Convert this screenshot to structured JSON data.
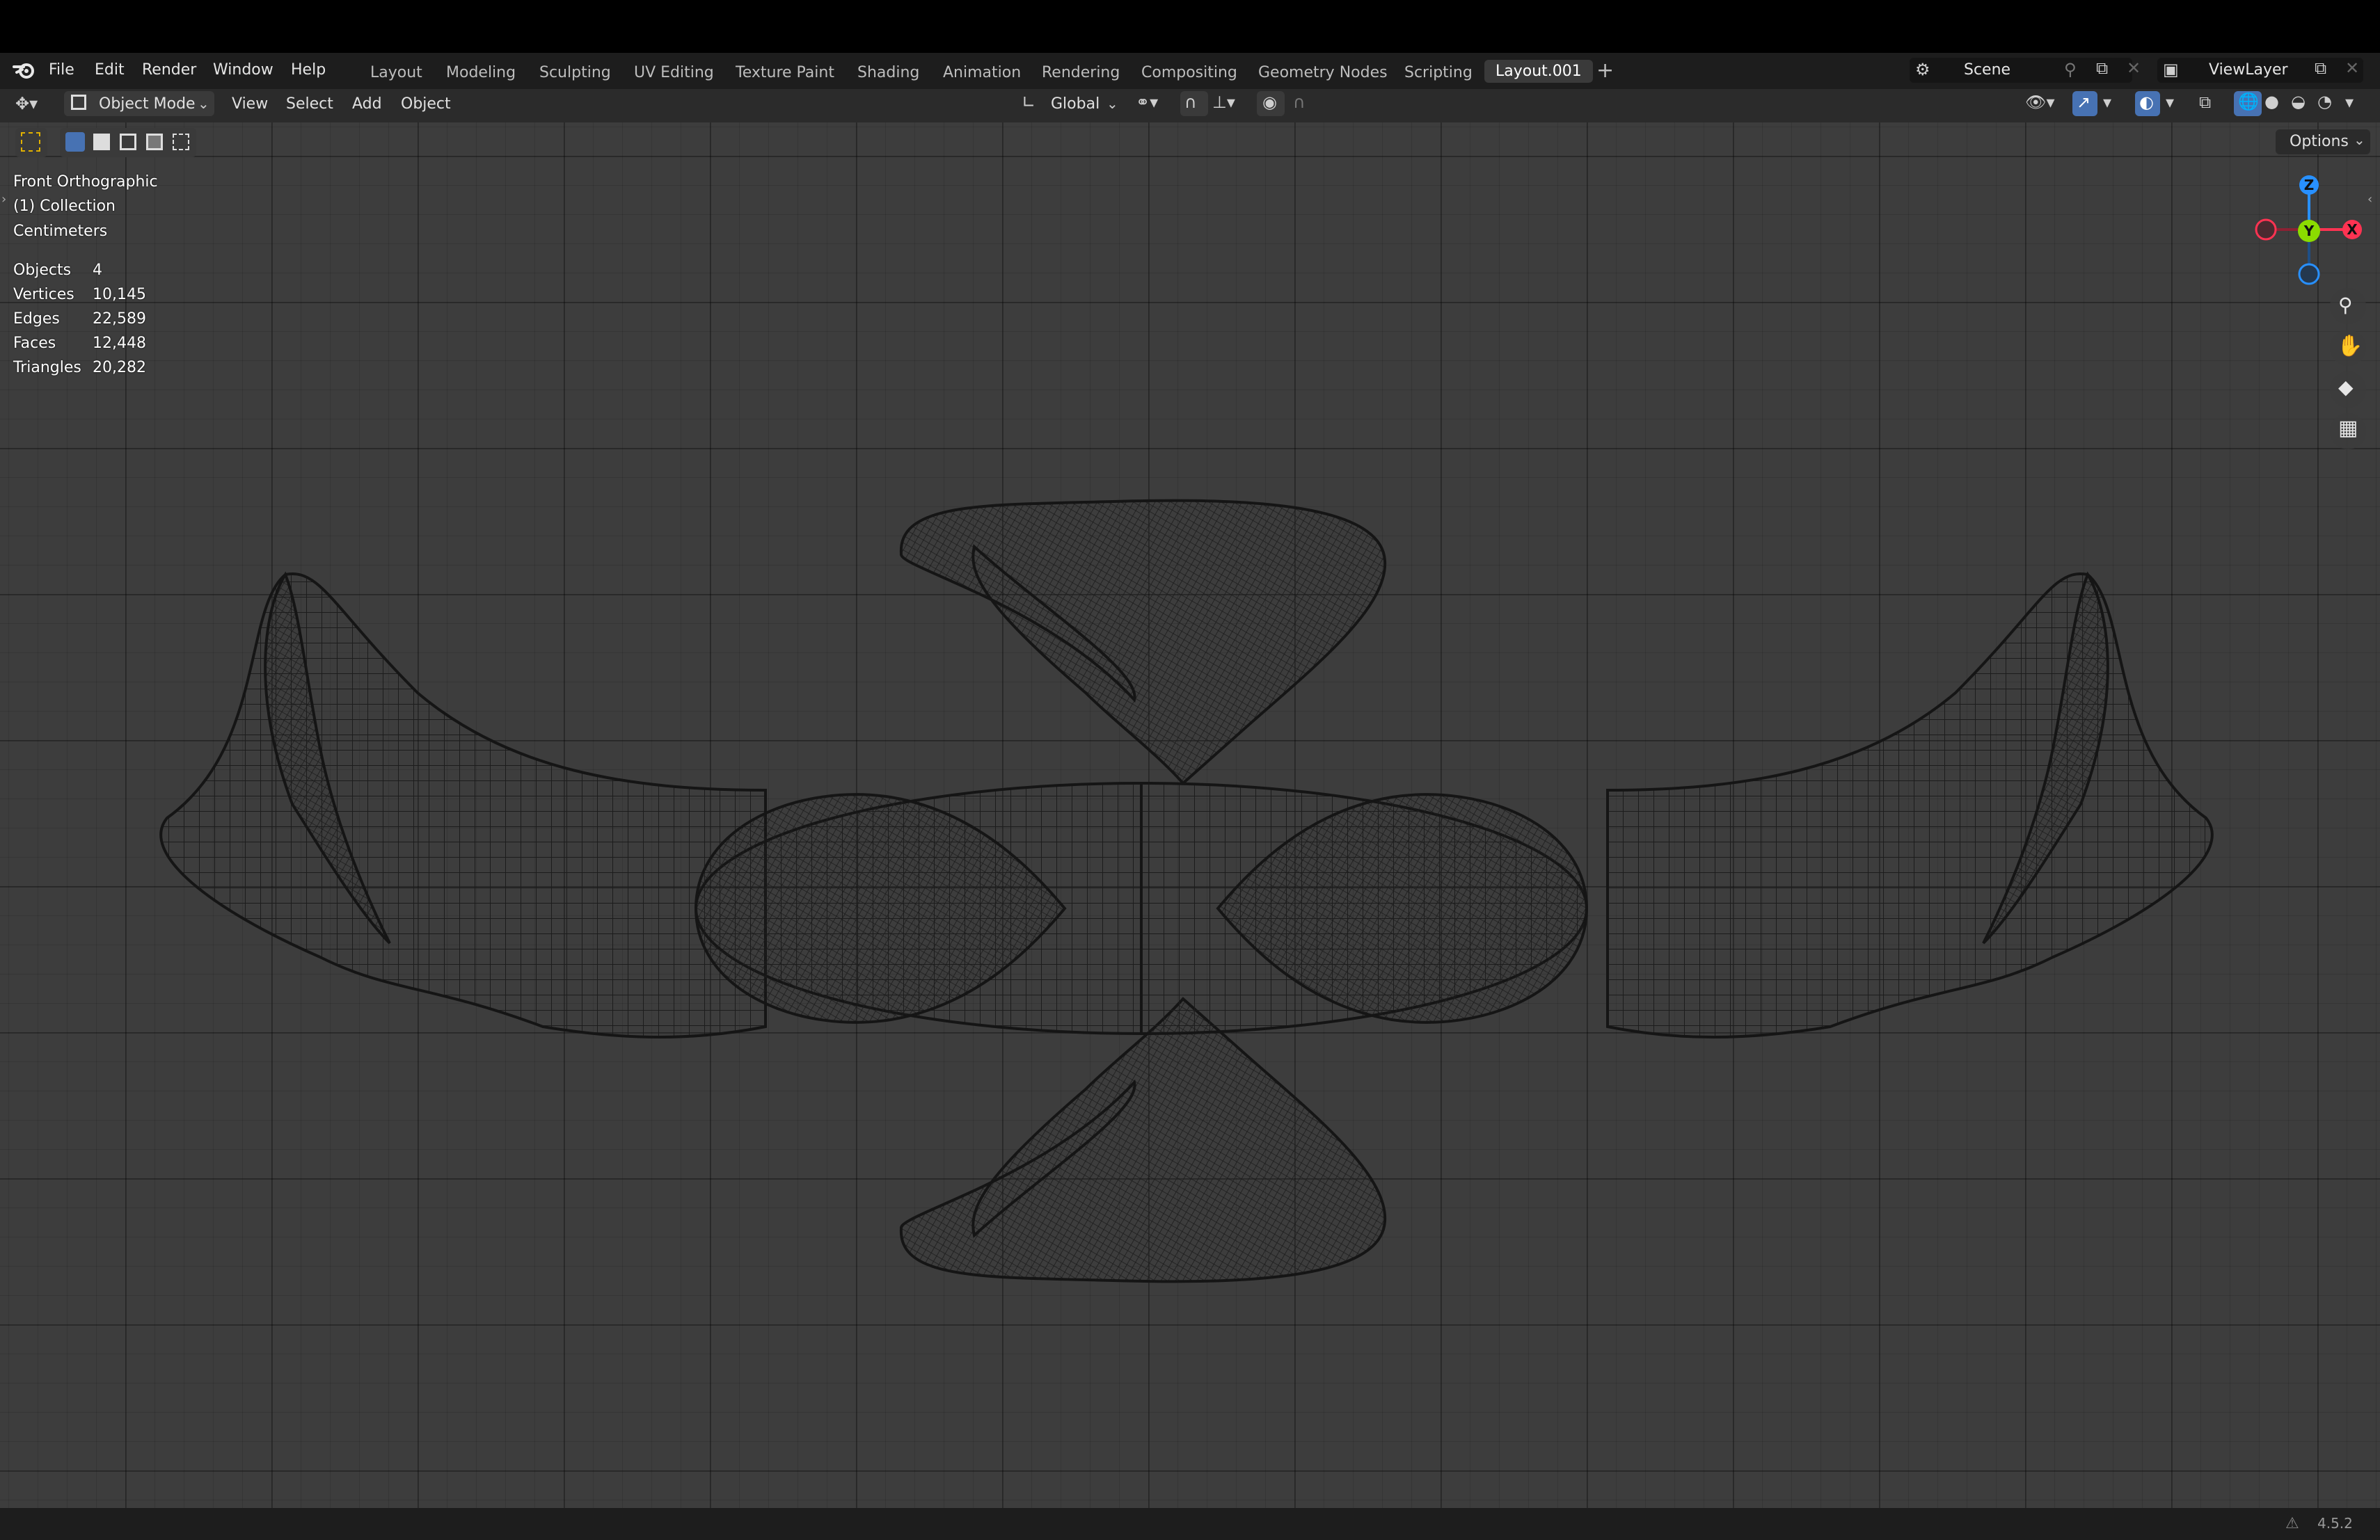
{
  "topbar": {
    "menus": [
      "File",
      "Edit",
      "Render",
      "Window",
      "Help"
    ],
    "workspace_tabs": [
      "Layout",
      "Modeling",
      "Sculpting",
      "UV Editing",
      "Texture Paint",
      "Shading",
      "Animation",
      "Rendering",
      "Compositing",
      "Geometry Nodes",
      "Scripting",
      "Layout.001"
    ],
    "active_tab": "Layout.001",
    "add_tab_icon": "+",
    "scene_name": "Scene",
    "view_layer_name": "ViewLayer"
  },
  "header": {
    "mode": "Object Mode",
    "menus": [
      "View",
      "Select",
      "Add",
      "Object"
    ],
    "transform_orientation": "Global",
    "options_label": "Options"
  },
  "viewport_info": {
    "view_name": "Front Orthographic",
    "collection": "(1) Collection",
    "units": "Centimeters",
    "stats": [
      {
        "label": "Objects",
        "value": "4"
      },
      {
        "label": "Vertices",
        "value": "10,145"
      },
      {
        "label": "Edges",
        "value": "22,589"
      },
      {
        "label": "Faces",
        "value": "12,448"
      },
      {
        "label": "Triangles",
        "value": "20,282"
      }
    ]
  },
  "gizmo": {
    "z": "Z",
    "y": "Y",
    "x": "X"
  },
  "status": {
    "version": "4.5.2"
  },
  "colors": {
    "accent": "#4772b3",
    "axis_x": "#ff3352",
    "axis_y": "#8bdc00",
    "axis_z": "#2890ff"
  }
}
